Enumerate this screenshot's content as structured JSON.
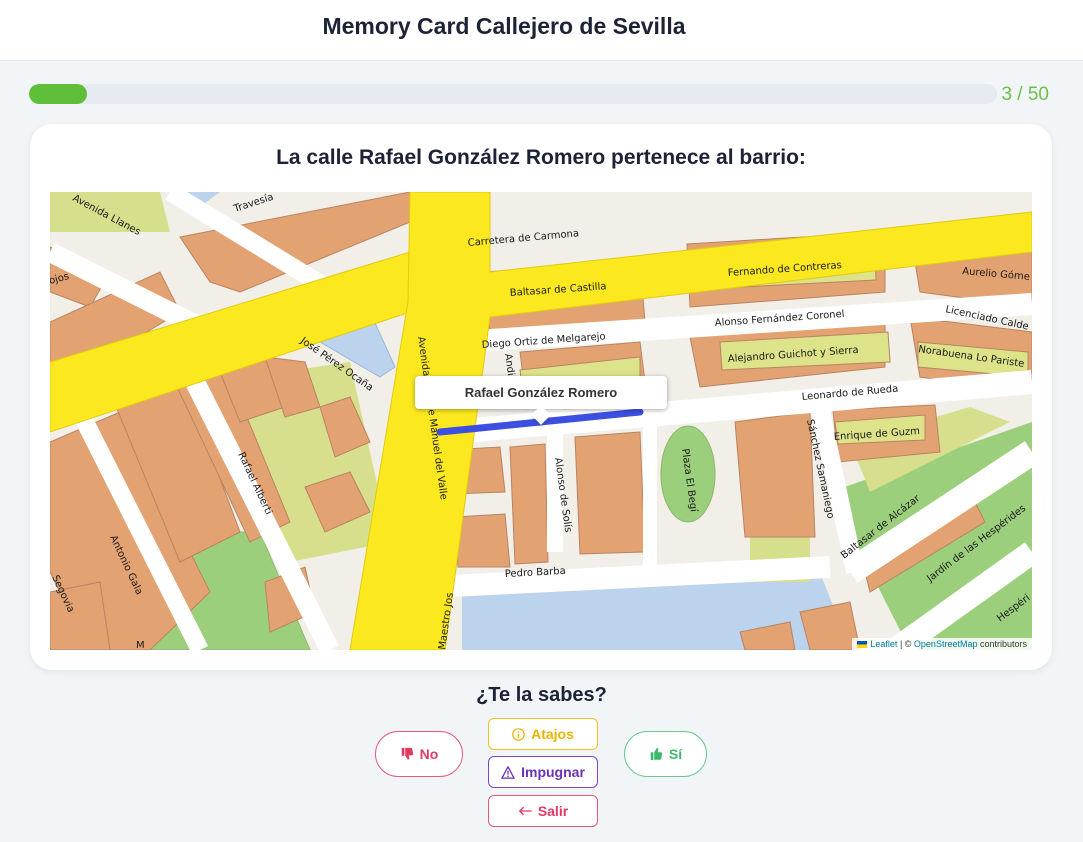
{
  "header": {
    "title": "Memory Card Callejero de Sevilla"
  },
  "progress": {
    "current": 3,
    "total": 50,
    "label": "3 / 50",
    "fraction": 0.06
  },
  "card": {
    "question": "La calle Rafael González Romero pertenece al barrio:",
    "map": {
      "tooltip": "Rafael González Romero",
      "streets": {
        "avenida_llanes": "Avenida Llanes",
        "travesia": "Travesía",
        "carretera_carmona": "Carretera de Carmona",
        "baltasar_castilla": "Baltasar de Castilla",
        "fernando_contreras": "Fernando de Contreras",
        "aurelio_gomez": "Aurelio Góme",
        "alonso_coronel": "Alonso Fernández Coronel",
        "licenciado_calde": "Licenciado Calde",
        "diego_ortiz": "Diego Ortiz de Melgarejo",
        "jose_perez": "José Pérez Ocaña",
        "avenida_alcalde": "Avenida Alcalde Manuel del Valle",
        "alejandro_guichot": "Alejandro Guichot y Sierra",
        "norabuena": "Norabuena Lo Pariste",
        "leonardo_rueda": "Leonardo de Rueda",
        "enrique_guzm": "Enrique de Guzm",
        "sanchez_samaniego": "Sánchez Samaniego",
        "rafael_alberti": "Rafael Alberti",
        "alonso_solis": "Alonso de Solís",
        "plaza_el_begi": "Plaza El Begí",
        "baltasar_alcazar": "Baltasar de Alcázar",
        "jardin_hesperides": "Jardín de las Hespérides",
        "hesperi": "Hespéri",
        "antonio_gala": "Antonio Gala",
        "segovia": "Segovia",
        "pedro_barba": "Pedro Barba",
        "maestro_jos": "Maestro Jos",
        "ojos": "ojos",
        "andi": "Andi",
        "m": "M"
      },
      "attribution": {
        "leaflet": "Leaflet",
        "separator": " | © ",
        "osm": "OpenStreetMap",
        "contributors": " contributors"
      }
    }
  },
  "prompt": "¿Te la sabes?",
  "buttons": {
    "no": "No",
    "atajos": "Atajos",
    "impugnar": "Impugnar",
    "salir": "Salir",
    "si": "Sí"
  },
  "icons": {
    "no": "thumbs-down-icon",
    "si": "thumbs-up-icon",
    "atajos": "info-circle-icon",
    "impugnar": "warning-triangle-icon",
    "salir": "arrow-left-icon"
  },
  "colors": {
    "progress": "#5fbf3b",
    "no": "#e03a62",
    "si": "#3cb86a",
    "atajos": "#e9b400",
    "impugnar": "#6a32b8",
    "highlight_street": "#3c4fe0",
    "main_road": "#fbe81e"
  }
}
